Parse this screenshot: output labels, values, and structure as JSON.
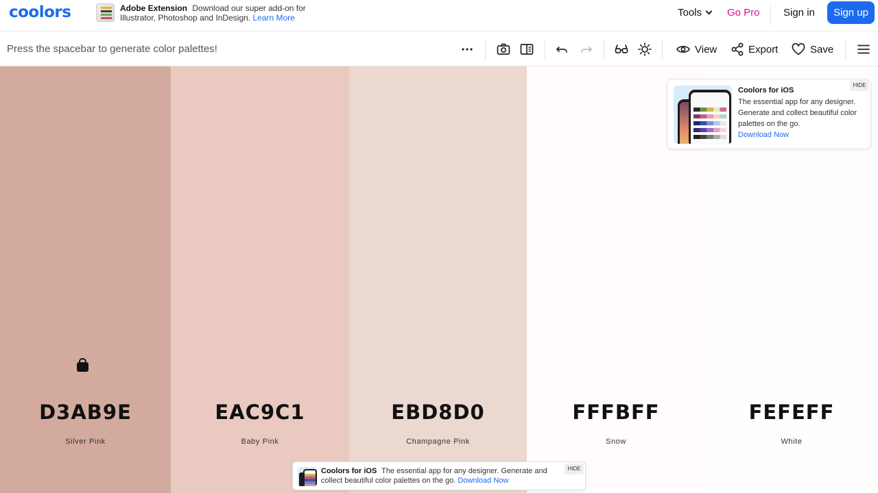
{
  "nav": {
    "logo": "coolors",
    "promo_title": "Adobe Extension",
    "promo_line1": "Download our super add-on for",
    "promo_line2": "Illustrator, Photoshop and InDesign.",
    "promo_link": "Learn More",
    "tools": "Tools",
    "gopro": "Go Pro",
    "signin": "Sign in",
    "signup": "Sign up"
  },
  "toolbar": {
    "hint": "Press the spacebar to generate color palettes!",
    "view": "View",
    "export": "Export",
    "save": "Save",
    "icons": [
      "more-icon",
      "camera-icon",
      "panels-icon",
      "undo-icon",
      "redo-icon",
      "glasses-icon",
      "brightness-icon",
      "eye-icon",
      "share-icon",
      "heart-icon",
      "menu-icon"
    ]
  },
  "palette": [
    {
      "hex": "D3AB9E",
      "name": "Silver Pink",
      "color": "#D3AB9E",
      "locked": true
    },
    {
      "hex": "EAC9C1",
      "name": "Baby Pink",
      "color": "#EAC9C1",
      "locked": false
    },
    {
      "hex": "EBD8D0",
      "name": "Champagne Pink",
      "color": "#EBD8D0",
      "locked": false
    },
    {
      "hex": "FFFBFF",
      "name": "Snow",
      "color": "#FFFBFF",
      "locked": false
    },
    {
      "hex": "FEFEFF",
      "name": "White",
      "color": "#FEFEFF",
      "locked": false
    }
  ],
  "ad_card": {
    "title": "Coolors for iOS",
    "body": "The essential app for any designer. Generate and collect beautiful color palettes on the go.",
    "link": "Download Now",
    "hide": "HIDE"
  },
  "ad_bottom": {
    "title": "Coolors for iOS",
    "body": "The essential app for any designer. Generate and collect beautiful color palettes on the go.",
    "link": "Download Now",
    "hide": "HIDE"
  },
  "colors": {
    "accent": "#1c6bef",
    "gopro": "#d21a8f"
  }
}
